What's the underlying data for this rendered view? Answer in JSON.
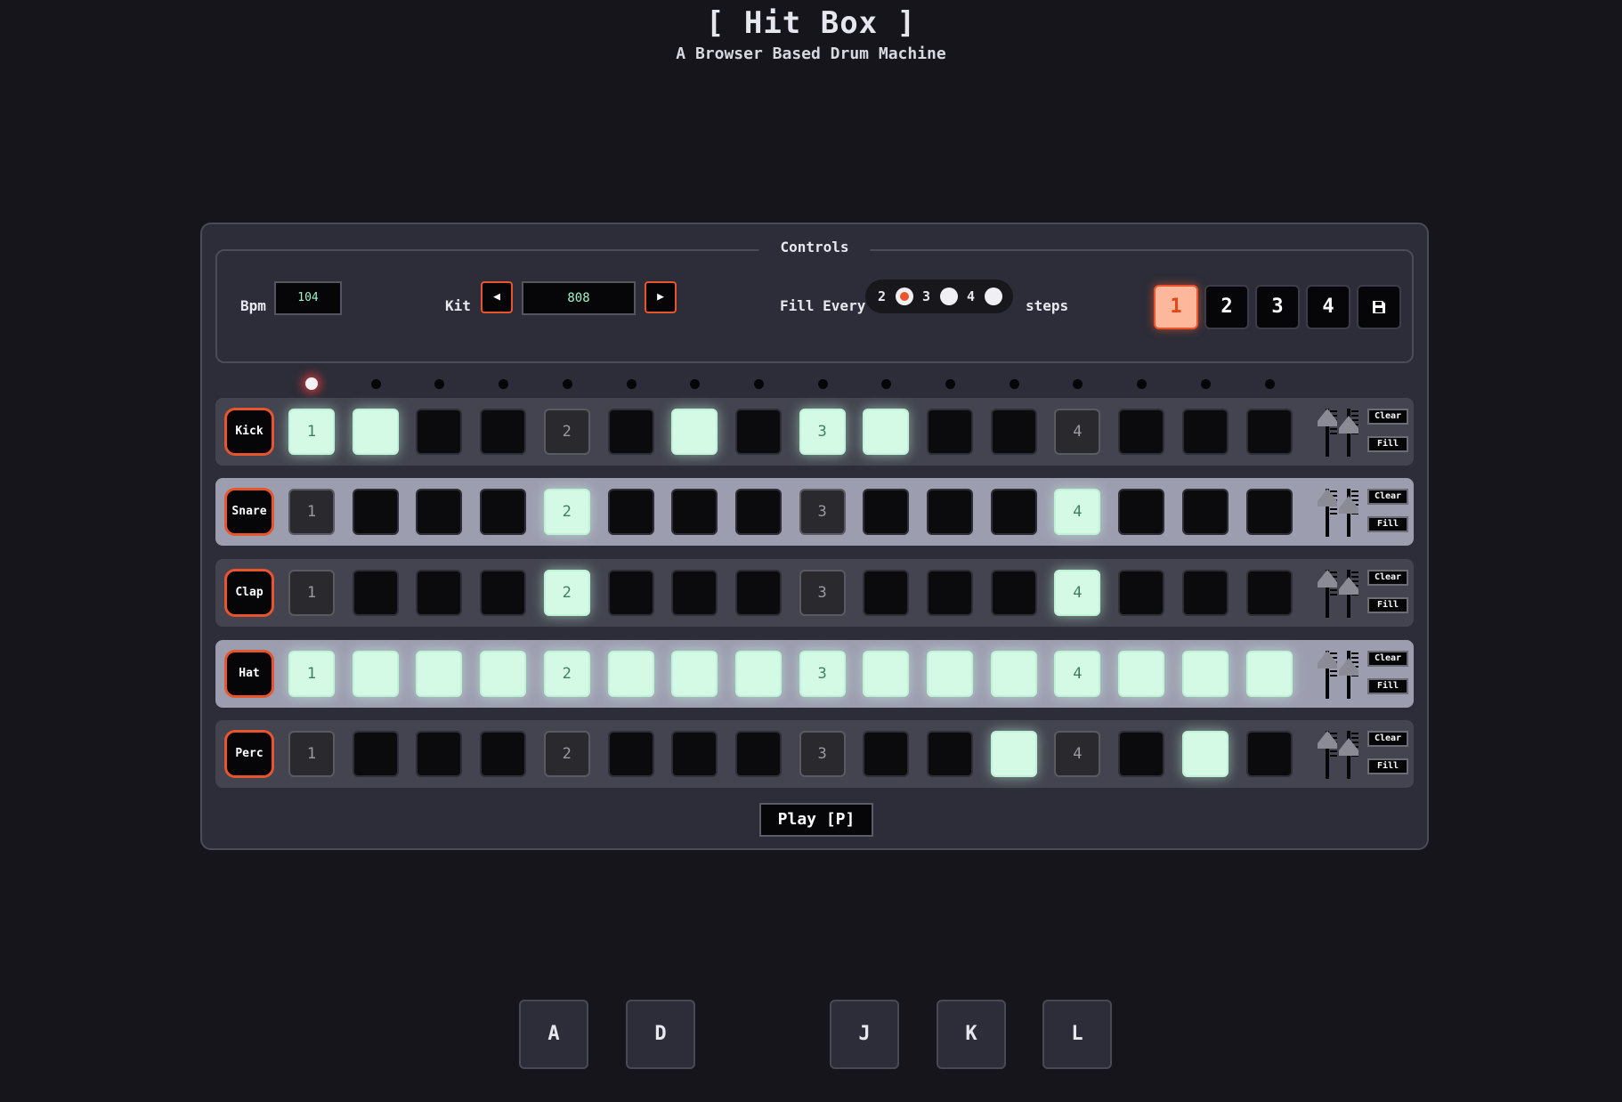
{
  "app": {
    "title": "[ Hit Box ]",
    "subtitle": "A Browser Based Drum Machine"
  },
  "controls": {
    "legend": "Controls",
    "bpm_label": "Bpm",
    "bpm_value": "104",
    "kit_label": "Kit",
    "kit_prev_label": "◀",
    "kit_next_label": "▶",
    "kit_value": "808",
    "fill_label": "Fill Every",
    "fill_options": [
      "2",
      "3",
      "4"
    ],
    "fill_selected": "2",
    "fill_suffix": "steps",
    "patterns": [
      "1",
      "2",
      "3",
      "4"
    ],
    "active_pattern": "1",
    "save_icon": "save-icon"
  },
  "sequencer": {
    "current_step": 1,
    "beat_labels": [
      "1",
      "2",
      "3",
      "4"
    ],
    "tracks": [
      {
        "name": "Kick",
        "steps": [
          1,
          1,
          0,
          0,
          0,
          0,
          1,
          0,
          1,
          1,
          0,
          0,
          0,
          0,
          0,
          0
        ]
      },
      {
        "name": "Snare",
        "steps": [
          0,
          0,
          0,
          0,
          1,
          0,
          0,
          0,
          0,
          0,
          0,
          0,
          1,
          0,
          0,
          0
        ]
      },
      {
        "name": "Clap",
        "steps": [
          0,
          0,
          0,
          0,
          1,
          0,
          0,
          0,
          0,
          0,
          0,
          0,
          1,
          0,
          0,
          0
        ]
      },
      {
        "name": "Hat",
        "steps": [
          1,
          1,
          1,
          1,
          1,
          1,
          1,
          1,
          1,
          1,
          1,
          1,
          1,
          1,
          1,
          1
        ]
      },
      {
        "name": "Perc",
        "steps": [
          0,
          0,
          0,
          0,
          0,
          0,
          0,
          0,
          0,
          0,
          0,
          1,
          0,
          0,
          1,
          0
        ]
      }
    ],
    "clear_label": "Clear",
    "fill_btn_label": "Fill"
  },
  "playback": {
    "play_label": "Play [P]"
  },
  "keyboard": {
    "keys": [
      "A",
      "D",
      "J",
      "K",
      "L"
    ]
  },
  "colors": {
    "accent": "#e8542c",
    "step_on": "#d4fae6",
    "lcd_text": "#9ff3c8"
  }
}
